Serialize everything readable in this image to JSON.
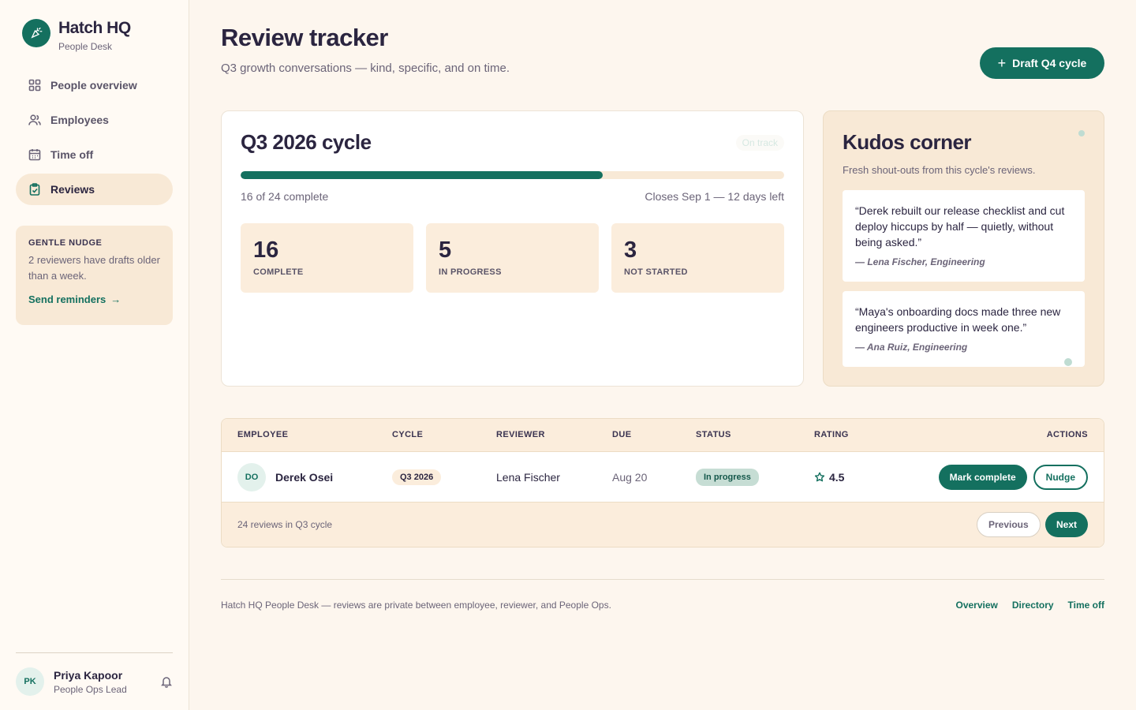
{
  "brand": {
    "name": "Hatch HQ",
    "subtitle": "People Desk"
  },
  "sidebar": {
    "items": [
      {
        "label": "People overview",
        "icon": "grid-icon",
        "active": false
      },
      {
        "label": "Employees",
        "icon": "users-icon",
        "active": false
      },
      {
        "label": "Time off",
        "icon": "calendar-icon",
        "active": false
      },
      {
        "label": "Reviews",
        "icon": "clipboard-check-icon",
        "active": true
      }
    ],
    "nudge": {
      "title": "GENTLE NUDGE",
      "text": "2 reviewers have drafts older than a week.",
      "link": "Send reminders",
      "link_arrow": "→"
    },
    "user": {
      "initials": "PK",
      "name": "Priya Kapoor",
      "role": "People Ops Lead"
    }
  },
  "header": {
    "title": "Review tracker",
    "subtitle": "Q3 growth conversations — kind, specific, and on time.",
    "draft_button": "Draft Q4 cycle",
    "draft_button_icon": "+"
  },
  "cycle": {
    "title": "Q3 2026 cycle",
    "status": "On track",
    "progress_fraction": 0.6667,
    "progress_left": "16 of 24 complete",
    "progress_right": "Closes Sep 1 — 12 days left",
    "stats": [
      {
        "value": "16",
        "label": "COMPLETE"
      },
      {
        "value": "5",
        "label": "IN PROGRESS"
      },
      {
        "value": "3",
        "label": "NOT STARTED"
      }
    ]
  },
  "kudos": {
    "title": "Kudos corner",
    "subtitle": "Fresh shout-outs from this cycle's reviews.",
    "quotes": [
      {
        "text": "“Derek rebuilt our release checklist and cut deploy hiccups by half — quietly, without being asked.”",
        "author": "— Lena Fischer, Engineering"
      },
      {
        "text": "“Maya's onboarding docs made three new engineers productive in week one.”",
        "author": "— Ana Ruiz, Engineering"
      }
    ]
  },
  "table": {
    "columns": [
      "EMPLOYEE",
      "CYCLE",
      "REVIEWER",
      "DUE",
      "STATUS",
      "RATING",
      "ACTIONS"
    ],
    "rows": [
      {
        "initials": "DO",
        "employee": "Derek Osei",
        "cycle": "Q3 2026",
        "reviewer": "Lena Fischer",
        "due": "Aug 20",
        "status": "In progress",
        "rating": "4.5",
        "actions": [
          "Mark complete",
          "Nudge"
        ]
      }
    ],
    "footer_text": "24 reviews in Q3 cycle",
    "prev": "Previous",
    "next": "Next"
  },
  "footer": {
    "text": "Hatch HQ People Desk — reviews are private between employee, reviewer, and People Ops.",
    "links": [
      "Overview",
      "Directory",
      "Time off"
    ]
  },
  "colors": {
    "accent": "#14705f",
    "background": "#fdf6ee",
    "panel": "#f8e9d6",
    "text": "#2b2540"
  }
}
